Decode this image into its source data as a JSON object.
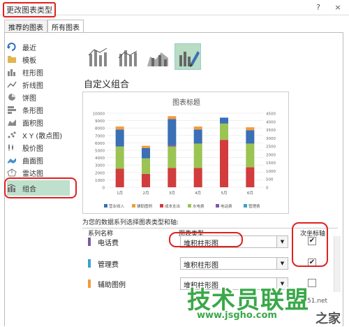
{
  "window": {
    "title": "更改图表类型",
    "help": "?",
    "close": "×"
  },
  "tabs": [
    {
      "label": "推荐的图表"
    },
    {
      "label": "所有图表"
    }
  ],
  "sidebar": {
    "items": [
      {
        "label": "最近",
        "icon": "recent-icon"
      },
      {
        "label": "模板",
        "icon": "folder-icon"
      },
      {
        "label": "柱形图",
        "icon": "column-chart-icon"
      },
      {
        "label": "折线图",
        "icon": "line-chart-icon"
      },
      {
        "label": "饼图",
        "icon": "pie-chart-icon"
      },
      {
        "label": "条形图",
        "icon": "bar-chart-icon"
      },
      {
        "label": "面积图",
        "icon": "area-chart-icon"
      },
      {
        "label": "X Y (散点图)",
        "icon": "scatter-chart-icon"
      },
      {
        "label": "股价图",
        "icon": "stock-chart-icon"
      },
      {
        "label": "曲面图",
        "icon": "surface-chart-icon"
      },
      {
        "label": "雷达图",
        "icon": "radar-chart-icon"
      },
      {
        "label": "组合",
        "icon": "combo-chart-icon"
      }
    ]
  },
  "section_title": "自定义组合",
  "series_prompt": "为您的数据系列选择图表类型和轴:",
  "grid": {
    "col_name": "系列名称",
    "col_type": "图表类型",
    "col_axis": "次坐标轴",
    "rows": [
      {
        "name": "电话费",
        "type": "堆积柱形图",
        "color": "#7e5aa0",
        "secondary": "✔"
      },
      {
        "name": "管理费",
        "type": "堆积柱形图",
        "color": "#3aa3c8",
        "secondary": "✔"
      },
      {
        "name": "辅助图例",
        "type": "堆积柱形图",
        "color": "#f49a3c",
        "secondary": ""
      }
    ]
  },
  "watermark": {
    "text": "技术员联盟",
    "url": "www.jsgho.com",
    "zhi": "之家",
    "frag": "51.net"
  },
  "chart_data": {
    "type": "bar",
    "title": "图表标题",
    "categories": [
      "1月",
      "2月",
      "3月",
      "4月",
      "5月",
      "6月"
    ],
    "ylim": [
      0,
      10000
    ],
    "y2lim": [
      0,
      4500
    ],
    "yticks": [
      0,
      1000,
      2000,
      3000,
      4000,
      5000,
      6000,
      7000,
      8000,
      9000,
      10000
    ],
    "y2ticks": [
      0,
      500,
      1000,
      1500,
      2000,
      2500,
      3000,
      3500,
      4000,
      4500
    ],
    "series": [
      {
        "name": "营业收入",
        "color": "#3b6fb6",
        "values": [
          0,
          0,
          0,
          0,
          0,
          0
        ]
      },
      {
        "name": "辅助图例",
        "color": "#f49a3c",
        "values": [
          0,
          0,
          0,
          0,
          0,
          0
        ]
      },
      {
        "name": "成本支出",
        "color": "#d23c3c",
        "values": [
          2500,
          1800,
          2600,
          2600,
          6400,
          2700
        ]
      },
      {
        "name": "水电费",
        "color": "#9bc453",
        "values": [
          3000,
          2100,
          2900,
          3300,
          2200,
          3200
        ]
      },
      {
        "name": "电话费",
        "color": "#7e5aa0",
        "values": [
          0,
          0,
          200,
          0,
          0,
          0
        ]
      },
      {
        "name": "管理费",
        "color": "#3aa3c8",
        "values": [
          0,
          0,
          0,
          0,
          0,
          0
        ]
      },
      {
        "name": "营业收入_top",
        "color": "#3b6fb6",
        "values": [
          2300,
          1400,
          3500,
          1900,
          800,
          1800
        ]
      },
      {
        "name": "辅助_top",
        "color": "#f49a3c",
        "values": [
          400,
          300,
          400,
          400,
          0,
          400
        ]
      }
    ],
    "legend": [
      "营业收入",
      "辅助图例",
      "成本支出",
      "水电费",
      "电话费",
      "管理费"
    ],
    "legend_colors": [
      "#3b6fb6",
      "#f49a3c",
      "#d23c3c",
      "#9bc453",
      "#7e5aa0",
      "#3aa3c8"
    ]
  }
}
